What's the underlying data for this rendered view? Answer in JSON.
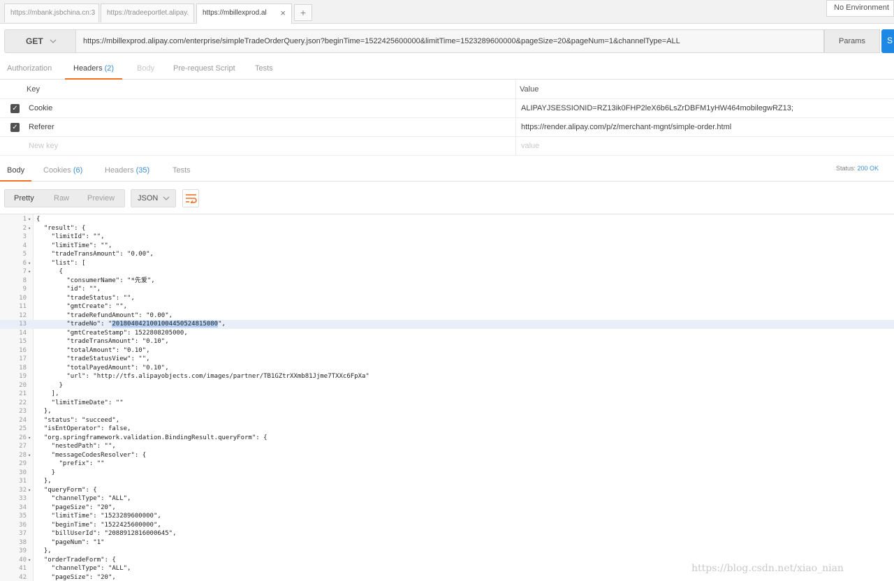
{
  "tabs": [
    {
      "label": "https://mbank.jsbchina.cn:3"
    },
    {
      "label": "https://tradeeportlet.alipay."
    },
    {
      "label": "https://mbillexprod.al"
    }
  ],
  "new_tab_label": "+",
  "close_label": "×",
  "environment": "No Environment",
  "request": {
    "method": "GET",
    "url": "https://mbillexprod.alipay.com/enterprise/simpleTradeOrderQuery.json?beginTime=1522425600000&limitTime=1523289600000&pageSize=20&pageNum=1&channelType=ALL",
    "params_label": "Params",
    "send_label": "S"
  },
  "request_tabs": [
    {
      "label": "Authorization"
    },
    {
      "label": "Headers",
      "count": "(2)"
    },
    {
      "label": "Body"
    },
    {
      "label": "Pre-request Script"
    },
    {
      "label": "Tests"
    }
  ],
  "headers_table": {
    "key_header": "Key",
    "value_header": "Value",
    "rows": [
      {
        "key": "Cookie",
        "value": "ALIPAYJSESSIONID=RZ13ik0FHP2leX6b6LsZrDBFM1yHW464mobilegwRZ13;"
      },
      {
        "key": "Referer",
        "value": "https://render.alipay.com/p/z/merchant-mgnt/simple-order.html"
      }
    ],
    "new_key_placeholder": "New key",
    "new_value_placeholder": "value"
  },
  "response_tabs": [
    {
      "label": "Body"
    },
    {
      "label": "Cookies",
      "count": "(6)"
    },
    {
      "label": "Headers",
      "count": "(35)"
    },
    {
      "label": "Tests"
    }
  ],
  "status": {
    "label": "Status:",
    "value": "200 OK"
  },
  "view_modes": [
    "Pretty",
    "Raw",
    "Preview"
  ],
  "format": "JSON",
  "code_lines": [
    {
      "n": "1",
      "fold": true,
      "text": "{"
    },
    {
      "n": "2",
      "fold": true,
      "text": "  \"result\": {"
    },
    {
      "n": "3",
      "text": "    \"limitId\": \"\","
    },
    {
      "n": "4",
      "text": "    \"limitTime\": \"\","
    },
    {
      "n": "5",
      "text": "    \"tradeTransAmount\": \"0.00\","
    },
    {
      "n": "6",
      "fold": true,
      "text": "    \"list\": ["
    },
    {
      "n": "7",
      "fold": true,
      "text": "      {"
    },
    {
      "n": "8",
      "text": "        \"consumerName\": \"*先爱\","
    },
    {
      "n": "9",
      "text": "        \"id\": \"\","
    },
    {
      "n": "10",
      "text": "        \"tradeStatus\": \"\","
    },
    {
      "n": "11",
      "text": "        \"gmtCreate\": \"\","
    },
    {
      "n": "12",
      "text": "        \"tradeRefundAmount\": \"0.00\","
    },
    {
      "n": "13",
      "hl": true,
      "pre": "        \"tradeNo\": \"",
      "sel": "2018040421001004450524815080",
      "post": "\","
    },
    {
      "n": "14",
      "text": "        \"gmtCreateStamp\": 1522808205000,"
    },
    {
      "n": "15",
      "text": "        \"tradeTransAmount\": \"0.10\","
    },
    {
      "n": "16",
      "text": "        \"totalAmount\": \"0.10\","
    },
    {
      "n": "17",
      "text": "        \"tradeStatusView\": \"\","
    },
    {
      "n": "18",
      "text": "        \"totalPayedAmount\": \"0.10\","
    },
    {
      "n": "19",
      "text": "        \"url\": \"http://tfs.alipayobjects.com/images/partner/TB1GZtrXXmb81Jjme7TXXc6FpXa\""
    },
    {
      "n": "20",
      "text": "      }"
    },
    {
      "n": "21",
      "text": "    ],"
    },
    {
      "n": "22",
      "text": "    \"limitTimeDate\": \"\""
    },
    {
      "n": "23",
      "text": "  },"
    },
    {
      "n": "24",
      "text": "  \"status\": \"succeed\","
    },
    {
      "n": "25",
      "text": "  \"isEntOperator\": false,"
    },
    {
      "n": "26",
      "fold": true,
      "text": "  \"org.springframework.validation.BindingResult.queryForm\": {"
    },
    {
      "n": "27",
      "text": "    \"nestedPath\": \"\","
    },
    {
      "n": "28",
      "fold": true,
      "text": "    \"messageCodesResolver\": {"
    },
    {
      "n": "29",
      "text": "      \"prefix\": \"\""
    },
    {
      "n": "30",
      "text": "    }"
    },
    {
      "n": "31",
      "text": "  },"
    },
    {
      "n": "32",
      "fold": true,
      "text": "  \"queryForm\": {"
    },
    {
      "n": "33",
      "text": "    \"channelType\": \"ALL\","
    },
    {
      "n": "34",
      "text": "    \"pageSize\": \"20\","
    },
    {
      "n": "35",
      "text": "    \"limitTime\": \"1523289600000\","
    },
    {
      "n": "36",
      "text": "    \"beginTime\": \"1522425600000\","
    },
    {
      "n": "37",
      "text": "    \"billUserId\": \"2088912816000645\","
    },
    {
      "n": "38",
      "text": "    \"pageNum\": \"1\""
    },
    {
      "n": "39",
      "text": "  },"
    },
    {
      "n": "40",
      "fold": true,
      "text": "  \"orderTradeForm\": {"
    },
    {
      "n": "41",
      "text": "    \"channelType\": \"ALL\","
    },
    {
      "n": "42",
      "text": "    \"pageSize\": \"20\","
    }
  ],
  "watermark": "https://blog.csdn.net/xiao_nian",
  "colors": {
    "accent": "#f37021",
    "link": "#3c8fd6",
    "send": "#1e88e5",
    "json_string": "#1a1aa6"
  }
}
